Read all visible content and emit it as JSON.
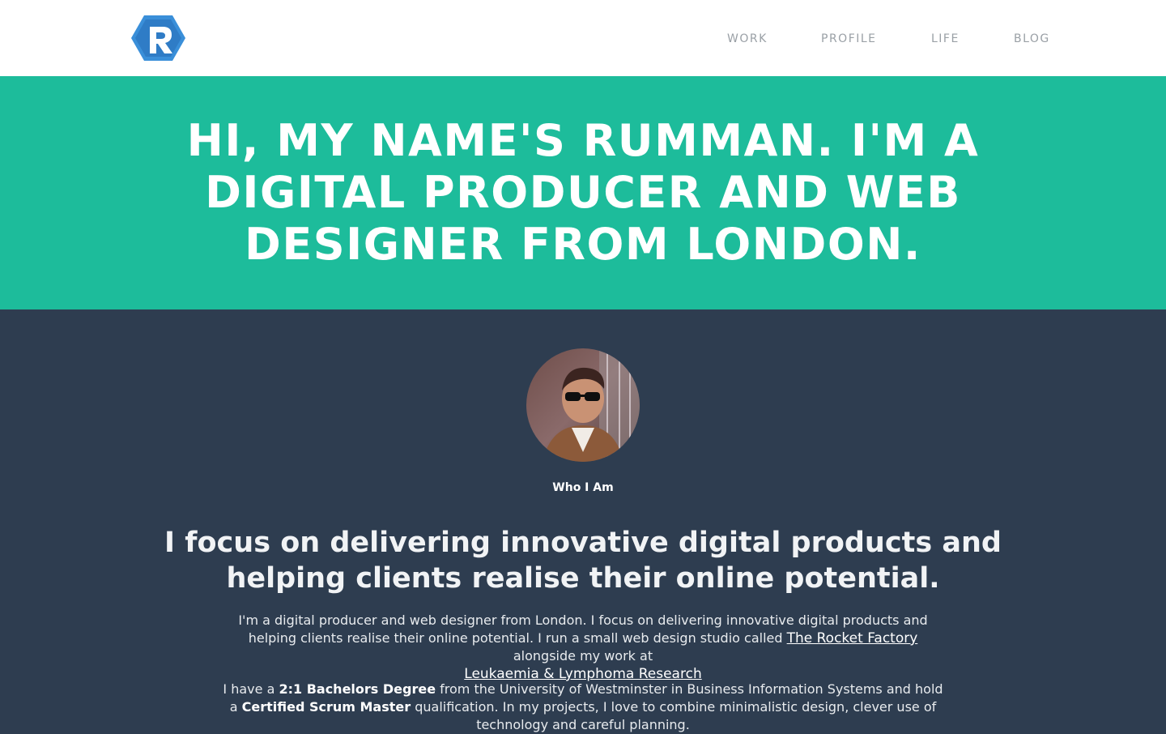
{
  "nav": {
    "items": [
      "WORK",
      "PROFILE",
      "LIFE",
      "BLOG"
    ]
  },
  "logo": {
    "letter": "R",
    "color": "#3a8fd9"
  },
  "hero": {
    "headline": "HI, MY NAME'S RUMMAN. I'M A DIGITAL PRODUCER AND WEB DESIGNER FROM LONDON.",
    "background": "#1dbc9b"
  },
  "about": {
    "caption": "Who I Am",
    "lead": "I focus on delivering innovative digital products and helping clients realise their online potential.",
    "para1": {
      "text_a": "I'm a digital producer and web designer from London. I focus on delivering innovative digital products and helping clients realise their online potential. I run a small web design studio called ",
      "link1": "The Rocket Factory",
      "text_b": " alongside my work at ",
      "link2": "Leukaemia & Lymphoma Research"
    },
    "para2": {
      "text_a": "I have a ",
      "bold1": "2:1 Bachelors Degree",
      "text_b": " from the University of Westminster in Business Information Systems and hold a ",
      "bold2": "Certified Scrum Master",
      "text_c": " qualification. In my projects, I love to combine minimalistic design, clever use of technology and careful planning."
    },
    "background": "#2e3d50"
  }
}
